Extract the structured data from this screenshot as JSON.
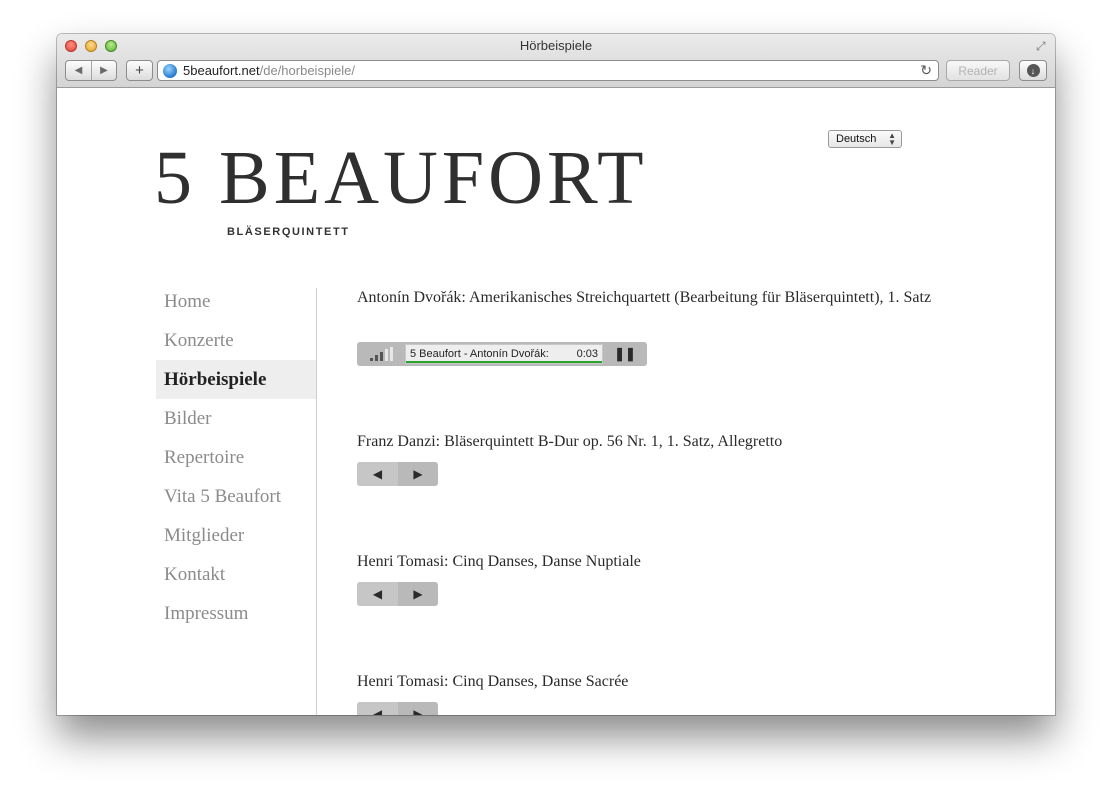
{
  "window": {
    "title": "Hörbeispiele"
  },
  "browser": {
    "url_host": "5beaufort.net",
    "url_path": "/de/horbeispiele/",
    "reader_label": "Reader",
    "back_icon": "◀",
    "forward_icon": "▶",
    "add_icon": "+",
    "reload_icon": "↻",
    "download_icon": "↓"
  },
  "logo": {
    "title": "5 BEAUFORT",
    "subtitle": "BLÄSERQUINTETT"
  },
  "language": {
    "selected": "Deutsch"
  },
  "nav": {
    "items": [
      {
        "label": "Home",
        "active": false
      },
      {
        "label": "Konzerte",
        "active": false
      },
      {
        "label": "Hörbeispiele",
        "active": true
      },
      {
        "label": "Bilder",
        "active": false
      },
      {
        "label": "Repertoire",
        "active": false
      },
      {
        "label": "Vita 5 Beaufort",
        "active": false
      },
      {
        "label": "Mitglieder",
        "active": false
      },
      {
        "label": "Kontakt",
        "active": false
      },
      {
        "label": "Impressum",
        "active": false
      }
    ]
  },
  "tracks": [
    {
      "title": "Antonín Dvořák: Amerikanisches Streichquartett (Bearbeitung für Bläserquintett), 1. Satz",
      "playing": true,
      "now_playing": "5 Beaufort - Antonín Dvořák:",
      "time": "0:03",
      "progress": 1.0
    },
    {
      "title": "Franz Danzi: Bläserquintett B-Dur op. 56 Nr. 1, 1. Satz, Allegretto",
      "playing": false
    },
    {
      "title": "Henri Tomasi: Cinq Danses, Danse Nuptiale",
      "playing": false
    },
    {
      "title": "Henri Tomasi: Cinq Danses, Danse Sacrée",
      "playing": false
    }
  ],
  "colors": {
    "progress": "#29a329",
    "active_nav_bg": "#eeeeee"
  }
}
